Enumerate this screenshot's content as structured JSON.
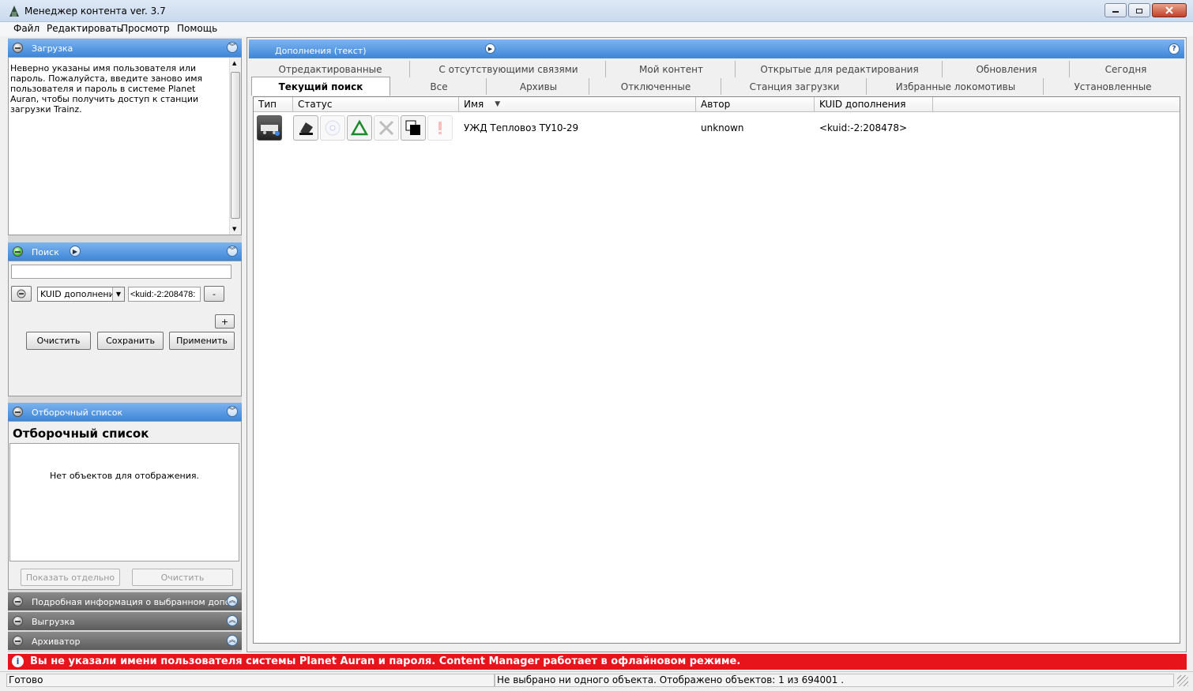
{
  "window": {
    "title": "Менеджер контента ver. 3.7"
  },
  "menu": [
    "Файл",
    "Редактировать",
    "Просмотр",
    "Помощь"
  ],
  "download_panel": {
    "title": "Загрузка",
    "message": "Неверно указаны имя пользователя или пароль. Пожалуйста, введите заново имя пользователя и пароль в системе Planet Auran, чтобы получить доступ к станции загрузки Trainz."
  },
  "search_panel": {
    "title": "Поиск",
    "search_value": "",
    "field_select": "KUID дополнения",
    "field_value": "<kuid:-2:208478:",
    "remove_label": "-",
    "add_label": "+",
    "clear_label": "Очистить",
    "save_label": "Сохранить",
    "apply_label": "Применить"
  },
  "shortlist_panel": {
    "title": "Отборочный список",
    "heading": "Отборочный список",
    "empty_text": "Нет объектов для отображения.",
    "show_separately_label": "Показать отдельно",
    "clear_label": "Очистить"
  },
  "collapsed_panels": [
    "Подробная информация о выбранном дополнении",
    "Выгрузка",
    "Архиватор"
  ],
  "content": {
    "header_title": "Дополнения (текст)",
    "tabs_row1": [
      "Отредактированные",
      "С отсутствующими связями",
      "Мой контент",
      "Открытые для редактирования",
      "Обновления",
      "Сегодня"
    ],
    "tabs_row2": [
      "Текущий поиск",
      "Все",
      "Архивы",
      "Отключенные",
      "Станция загрузки",
      "Избранные локомотивы",
      "Установленные"
    ],
    "active_tab": "Текущий поиск",
    "columns": [
      "Тип",
      "Статус",
      "Имя",
      "Автор",
      "KUID дополнения"
    ],
    "rows": [
      {
        "name": "УЖД Тепловоз ТУ10-29",
        "author": "unknown",
        "kuid": "<kuid:-2:208478>"
      }
    ]
  },
  "alert": {
    "text": "Вы не указали имени пользователя системы Planet Auran и пароля. Content Manager работает в офлайновом режиме."
  },
  "status": {
    "left": "Готово",
    "right": "Не выбрано ни одного объекта. Отображено объектов: 1 из 694001 ."
  },
  "colors": {
    "accent": "#3d86d8",
    "alert": "#e8141c"
  }
}
